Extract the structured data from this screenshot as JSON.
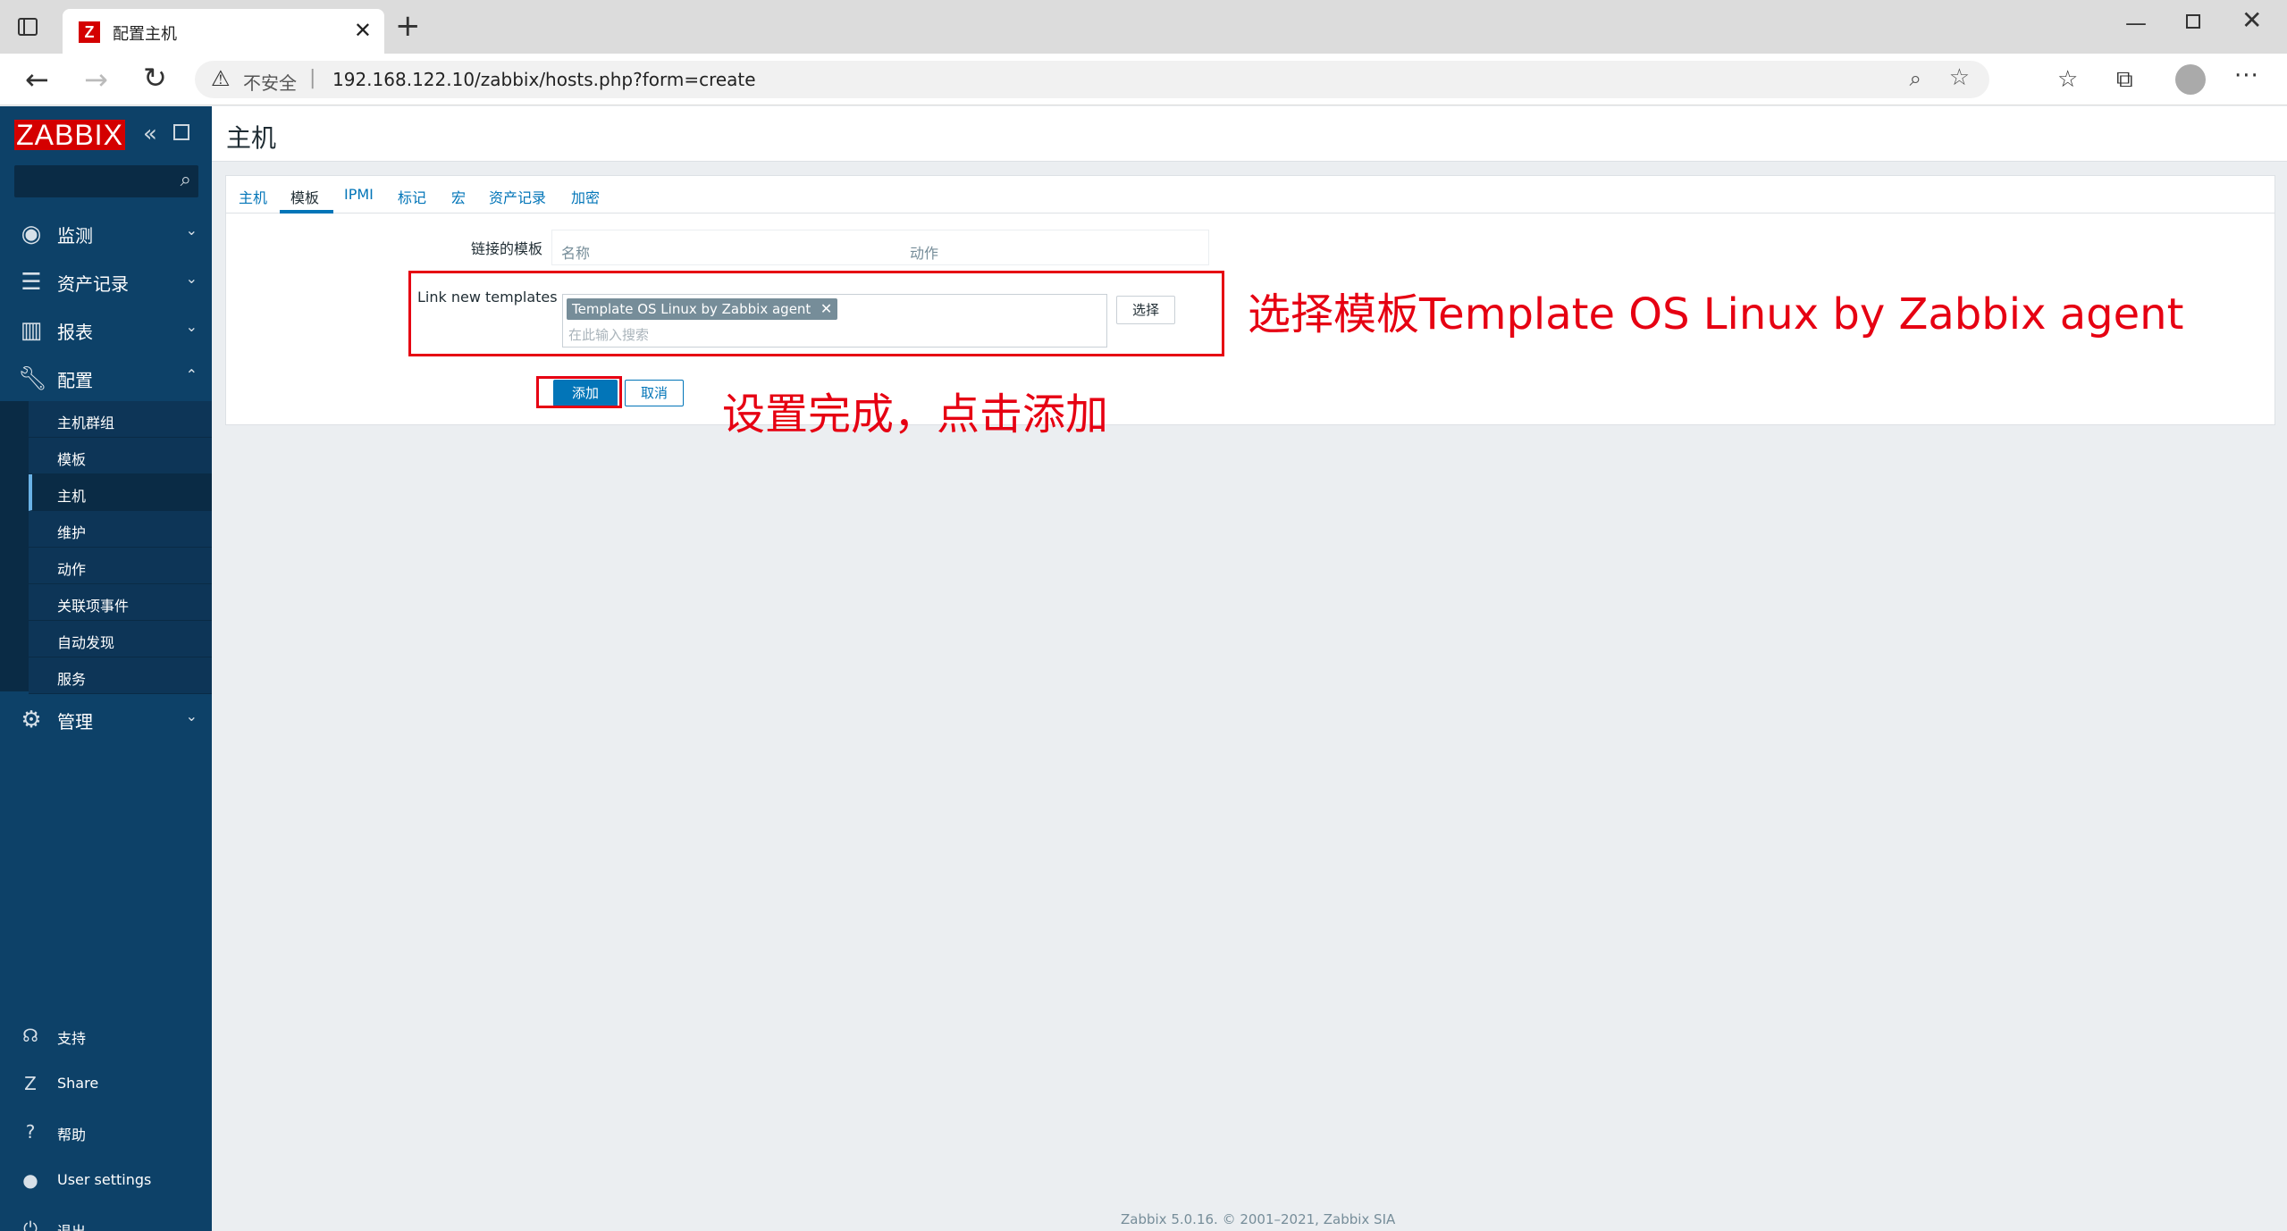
{
  "browser": {
    "tab_title": "配置主机",
    "favicon_letter": "Z",
    "new_tab": "+",
    "security_label": "不安全",
    "url": "192.168.122.10/zabbix/hosts.php?form=create"
  },
  "sidebar": {
    "logo": "ZABBIX",
    "menu": [
      {
        "label": "监测",
        "icon": "eye-icon"
      },
      {
        "label": "资产记录",
        "icon": "list-icon"
      },
      {
        "label": "报表",
        "icon": "bar-chart-icon"
      },
      {
        "label": "配置",
        "icon": "wrench-icon"
      },
      {
        "label": "管理",
        "icon": "gear-icon"
      }
    ],
    "submenu": [
      "主机群组",
      "模板",
      "主机",
      "维护",
      "动作",
      "关联项事件",
      "自动发现",
      "服务"
    ],
    "active_submenu": "主机",
    "utils": [
      {
        "label": "支持",
        "icon": "headset-icon"
      },
      {
        "label": "Share",
        "icon": "zabbix-share-icon"
      },
      {
        "label": "帮助",
        "icon": "help-icon"
      },
      {
        "label": "User settings",
        "icon": "user-icon"
      },
      {
        "label": "退出",
        "icon": "power-icon"
      }
    ]
  },
  "page": {
    "title": "主机",
    "tabs": [
      "主机",
      "模板",
      "IPMI",
      "标记",
      "宏",
      "资产记录",
      "加密"
    ],
    "active_tab": "模板",
    "linked_templates_label": "链接的模板",
    "table_headers": {
      "name": "名称",
      "action": "动作"
    },
    "link_new_label": "Link new templates",
    "selected_template": "Template OS Linux by Zabbix agent",
    "search_placeholder": "在此输入搜索",
    "select_button": "选择",
    "add_button": "添加",
    "cancel_button": "取消"
  },
  "annotations": {
    "note1": "选择模板Template OS Linux by Zabbix agent",
    "note2": "设置完成，点击添加",
    "color": "#e60012"
  },
  "footer": "Zabbix 5.0.16. © 2001–2021, Zabbix SIA"
}
